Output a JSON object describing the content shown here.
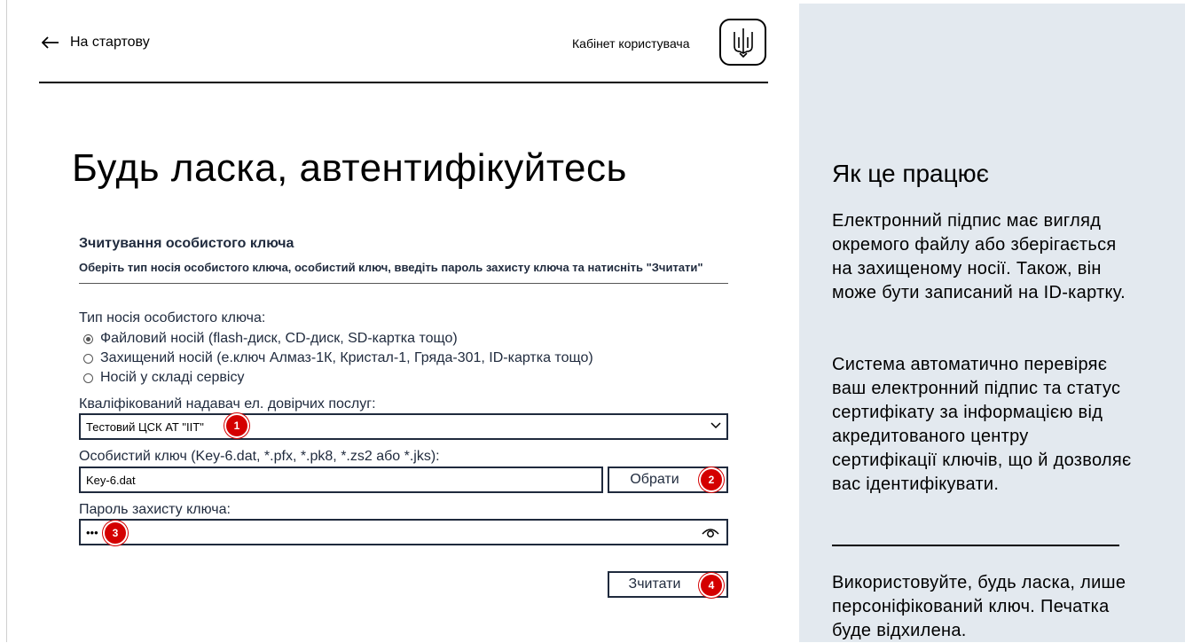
{
  "header": {
    "back_label": "На стартову",
    "cabinet_label": "Кабінет користувача"
  },
  "page_title": "Будь ласка, автентифікуйтесь",
  "form": {
    "title": "Зчитування особистого ключа",
    "instruction": "Оберіть тип носія особистого ключа, особистий ключ, введіть пароль захисту ключа та натисніть \"Зчитати\"",
    "media_type_label": "Тип носія особистого ключа:",
    "media_options": [
      {
        "label": "Файловий носій (flash-диск, CD-диск, SD-картка тощо)",
        "selected": true
      },
      {
        "label": "Захищений носій (е.ключ Алмаз-1К, Кристал-1, Гряда-301, ID-картка тощо)",
        "selected": false
      },
      {
        "label": "Носій у складі сервісу",
        "selected": false
      }
    ],
    "provider_label": "Кваліфікований надавач ел. довірчих послуг:",
    "provider_value": "Тестовий ЦСК АТ \"ІІТ\"",
    "key_label": "Особистий ключ (Key-6.dat, *.pfx, *.pk8, *.zs2 або *.jks):",
    "key_value": "Key-6.dat",
    "choose_button": "Обрати",
    "password_label": "Пароль захисту ключа:",
    "password_value": "•••",
    "read_button": "Зчитати"
  },
  "badges": [
    "1",
    "2",
    "3",
    "4"
  ],
  "side": {
    "title": "Як це працює",
    "p1": "Електронний підпис має вигляд окремого файлу або зберігається на захищеному носії. Також, він може бути записаний на ID-картку.",
    "p2": "Система автоматично перевіряє ваш електронний підпис та статус сертифікату за інформацією від акредитованого центру сертифікації ключів, що й дозволяє вас ідентифікувати.",
    "p3": "Використовуйте, будь ласка, лише персоніфікований ключ. Печатка буде відхилена."
  },
  "colors": {
    "badge": "#d40000",
    "side_bg": "#e3e9ef",
    "form_text": "#1f2a3d"
  },
  "icons": [
    "arrow-left-icon",
    "trident-icon",
    "chevron-down-icon",
    "eye-icon"
  ]
}
